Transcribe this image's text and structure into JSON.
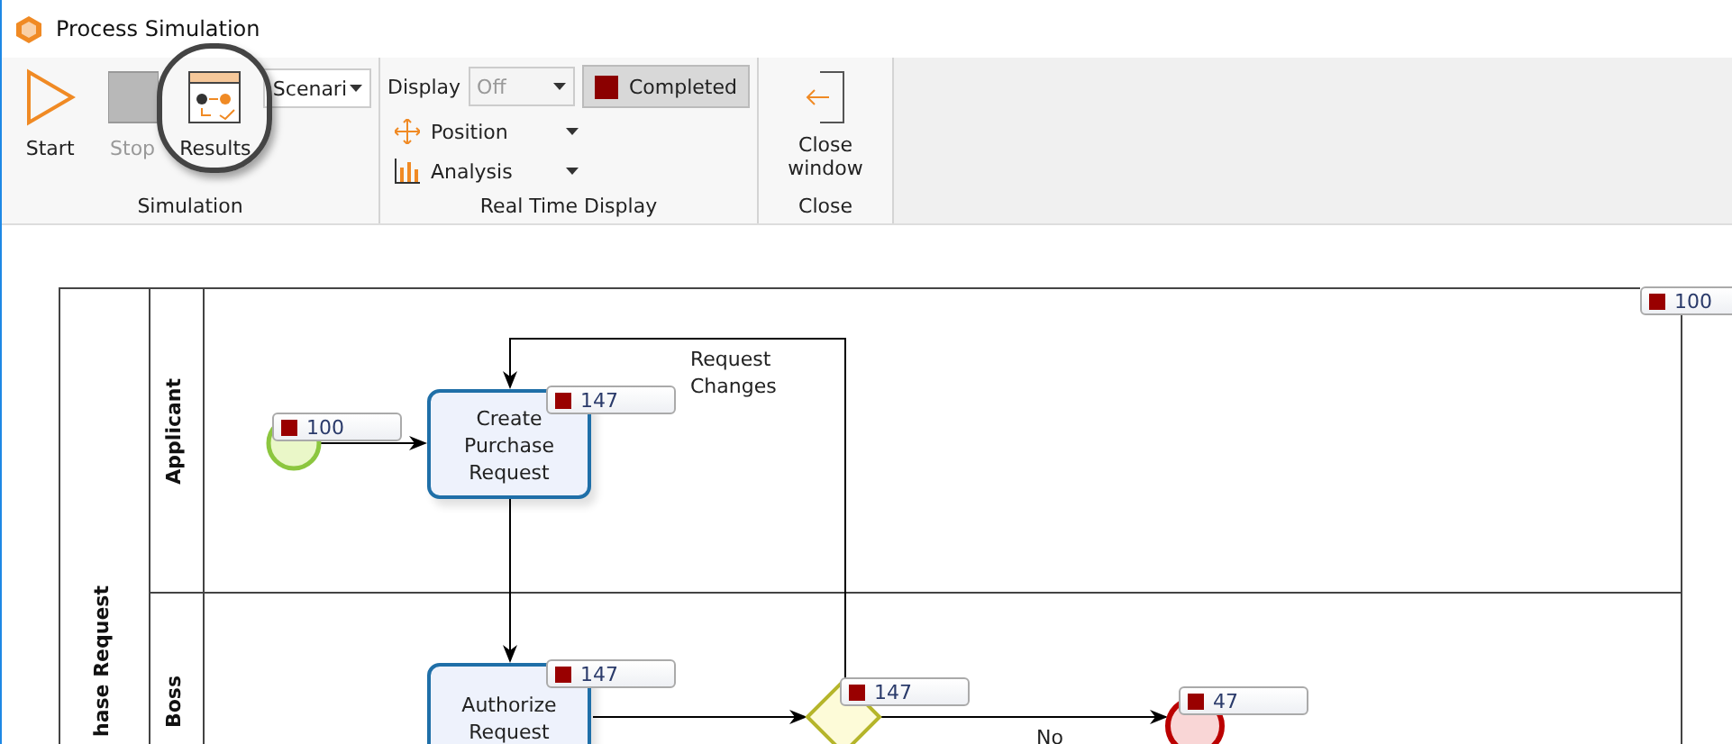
{
  "window": {
    "title": "Process Simulation"
  },
  "ribbon": {
    "start": {
      "label": "Start"
    },
    "stop": {
      "label": "Stop",
      "disabled": true
    },
    "results": {
      "label": "Results",
      "highlighted": true
    },
    "scenario": {
      "value": "Scenari"
    },
    "display": {
      "label": "Display",
      "value": "Off",
      "disabled": true
    },
    "completed": {
      "label": "Completed",
      "selected": true
    },
    "position": {
      "label": "Position"
    },
    "analysis": {
      "label": "Analysis"
    },
    "close_window": {
      "label": "Close window"
    },
    "groups": [
      "Simulation",
      "Real Time Display",
      "Close"
    ]
  },
  "diagram": {
    "pool_label": "hase Request",
    "pool_badge": "100",
    "lanes": [
      "Applicant",
      "Boss"
    ],
    "nodes": [
      {
        "kind": "start",
        "badge": "100"
      },
      {
        "kind": "task",
        "text": "Create Purchase Request",
        "badge": "147"
      },
      {
        "kind": "task",
        "text": "Authorize Request",
        "badge": "147"
      },
      {
        "kind": "gateway",
        "badge": "147"
      },
      {
        "kind": "end",
        "badge": "47"
      }
    ],
    "flow_labels": [
      "Request Changes",
      "No"
    ]
  }
}
